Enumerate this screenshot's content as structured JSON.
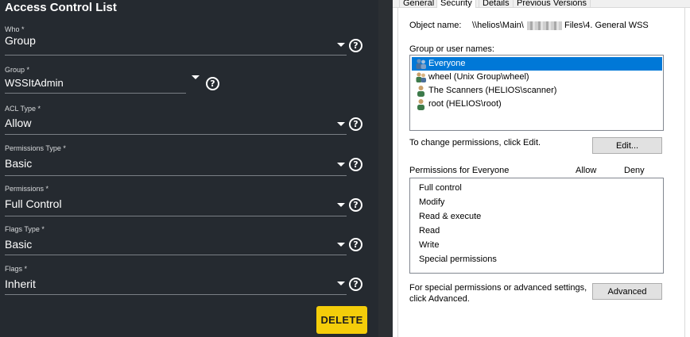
{
  "acl": {
    "title": "Access Control List",
    "fields": [
      {
        "label": "Who *",
        "value": "Group"
      },
      {
        "label": "Group *",
        "value": "WSSItAdmin"
      },
      {
        "label": "ACL Type *",
        "value": "Allow"
      },
      {
        "label": "Permissions Type *",
        "value": "Basic"
      },
      {
        "label": "Permissions *",
        "value": "Full Control"
      },
      {
        "label": "Flags Type *",
        "value": "Basic"
      },
      {
        "label": "Flags *",
        "value": "Inherit"
      }
    ],
    "help_glyph": "?",
    "delete_label": "DELETE",
    "colors": {
      "background": "#252a30",
      "button": "#f4cd0a"
    }
  },
  "dialog": {
    "tabs": [
      "General",
      "Security",
      "Details",
      "Previous Versions"
    ],
    "active_tab": "Security",
    "object_name_label": "Object name:",
    "object_name_prefix": "\\\\helios\\Main\\",
    "object_name_suffix": "Files\\4. General WSS",
    "group_users_label": "Group or user names:",
    "users": [
      {
        "name": "Everyone",
        "icon": "group-icon",
        "selected": true
      },
      {
        "name": "wheel (Unix Group\\wheel)",
        "icon": "group-icon",
        "selected": false
      },
      {
        "name": "The Scanners (HELIOS\\scanner)",
        "icon": "user-icon",
        "selected": false
      },
      {
        "name": "root (HELIOS\\root)",
        "icon": "user-icon",
        "selected": false
      }
    ],
    "change_hint": "To change permissions, click Edit.",
    "edit_label": "Edit...",
    "permissions_for": "Permissions for Everyone",
    "allow_header": "Allow",
    "deny_header": "Deny",
    "permissions": [
      "Full control",
      "Modify",
      "Read & execute",
      "Read",
      "Write",
      "Special permissions"
    ],
    "special_hint_line1": "For special permissions or advanced settings,",
    "special_hint_line2": "click Advanced.",
    "advanced_label": "Advanced",
    "colors": {
      "selection": "#0078d7"
    }
  }
}
